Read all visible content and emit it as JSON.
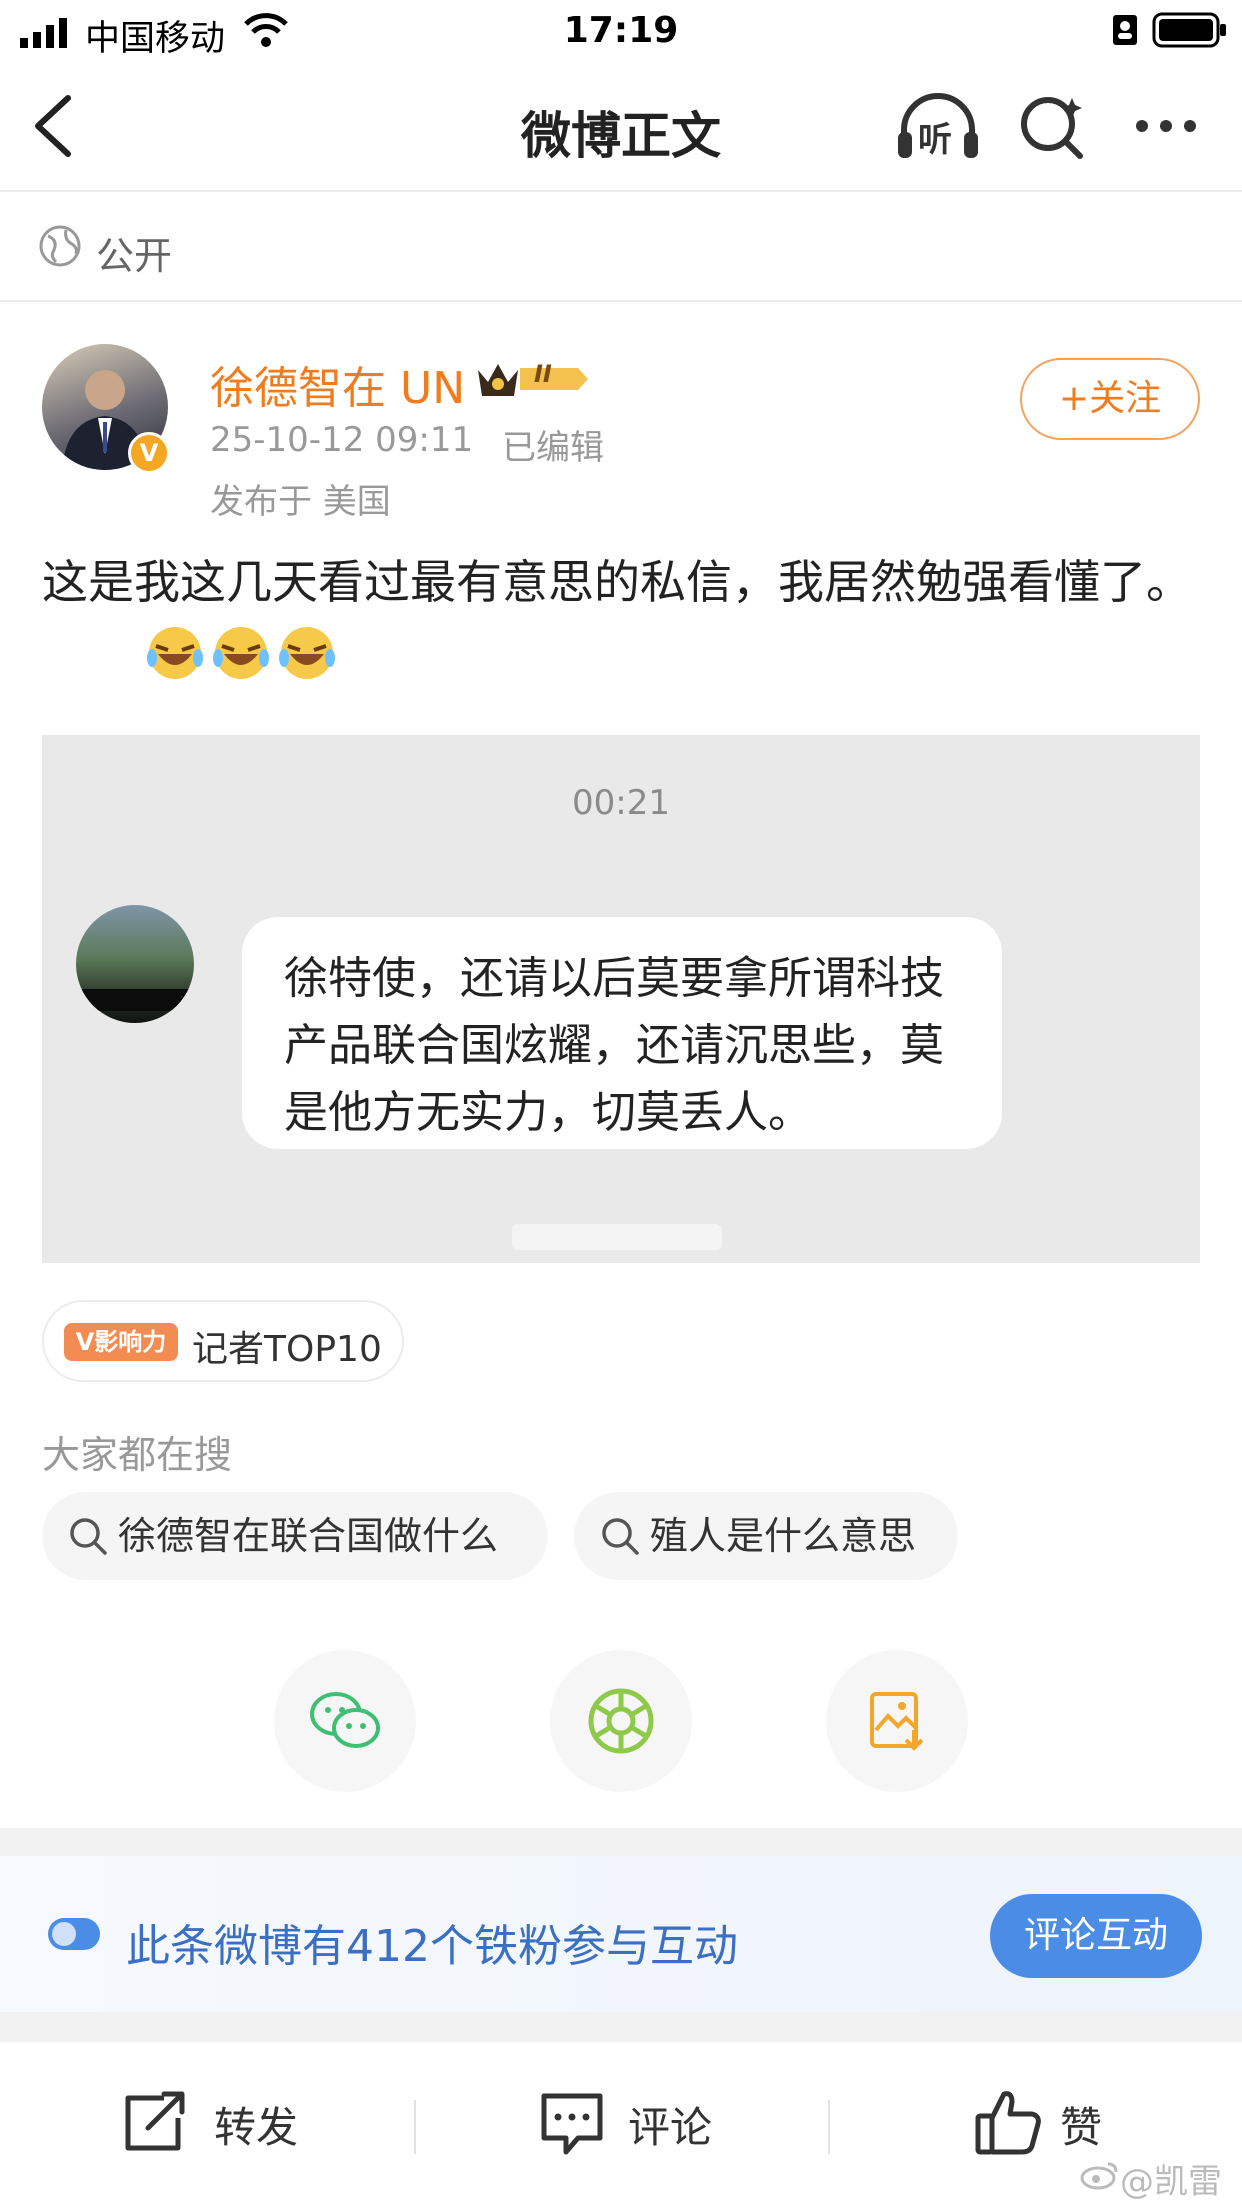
{
  "status_bar": {
    "carrier": "中国移动",
    "time": "17:19"
  },
  "nav": {
    "title": "微博正文",
    "listen_label": "听"
  },
  "privacy": {
    "label": "公开"
  },
  "author": {
    "name": "徐德智在 UN",
    "level_badge": "II",
    "verified_mark": "V",
    "time": "25-10-12 09:11",
    "edited": "已编辑",
    "location": "发布于 美国",
    "follow_label": "+关注"
  },
  "post": {
    "text": "这是我这几天看过最有意思的私信，我居然勉强看懂了。"
  },
  "media": {
    "timestamp": "00:21",
    "message": "徐特使，还请以后莫要拿所谓科技产品联合国炫耀，还请沉思些，莫是他方无实力，切莫丢人。"
  },
  "influence": {
    "badge": "V影响力",
    "text": "记者TOP10"
  },
  "hot_search": {
    "title": "大家都在搜",
    "items": [
      "徐德智在联合国做什么",
      "殖人是什么意思"
    ]
  },
  "share_icons": [
    "wechat-icon",
    "moments-icon",
    "save-image-icon"
  ],
  "fans_banner": {
    "text": "此条微博有412个铁粉参与互动",
    "button": "评论互动"
  },
  "toolbar": {
    "repost": "转发",
    "comment": "评论",
    "like": "赞"
  },
  "watermark": "@凯雷",
  "colors": {
    "accent_orange": "#f07c1e",
    "link_blue": "#3a6fc4",
    "button_blue": "#4a8ce6"
  }
}
